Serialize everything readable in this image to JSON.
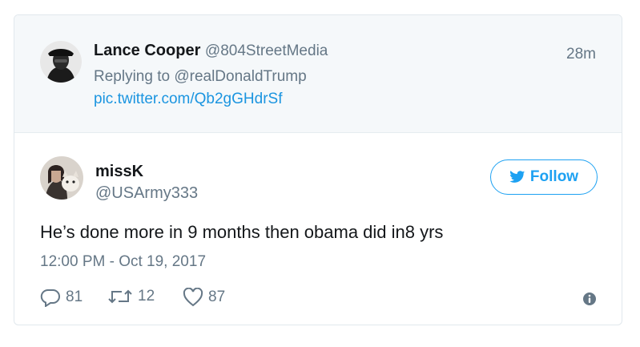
{
  "reply_context": {
    "author_name": "Lance Cooper",
    "author_handle": "@804StreetMedia",
    "replying_to": "Replying to @realDonaldTrump",
    "link": "pic.twitter.com/Qb2gGHdrSf",
    "time_ago": "28m"
  },
  "tweet": {
    "author_name": "missK",
    "author_handle": "@USArmy333",
    "follow_label": "Follow",
    "text": "He’s done more in 9 months then obama did in8 yrs",
    "timestamp": "12:00 PM - Oct 19, 2017",
    "replies": "81",
    "retweets": "12",
    "likes": "87"
  },
  "colors": {
    "accent": "#1da1f2",
    "link": "#1b95e0",
    "muted": "#657786",
    "reply_bg": "#f5f8fa"
  },
  "icons": [
    "avatar-lance",
    "avatar-missk",
    "twitter-bird-icon",
    "reply-icon",
    "retweet-icon",
    "heart-icon",
    "info-icon"
  ]
}
